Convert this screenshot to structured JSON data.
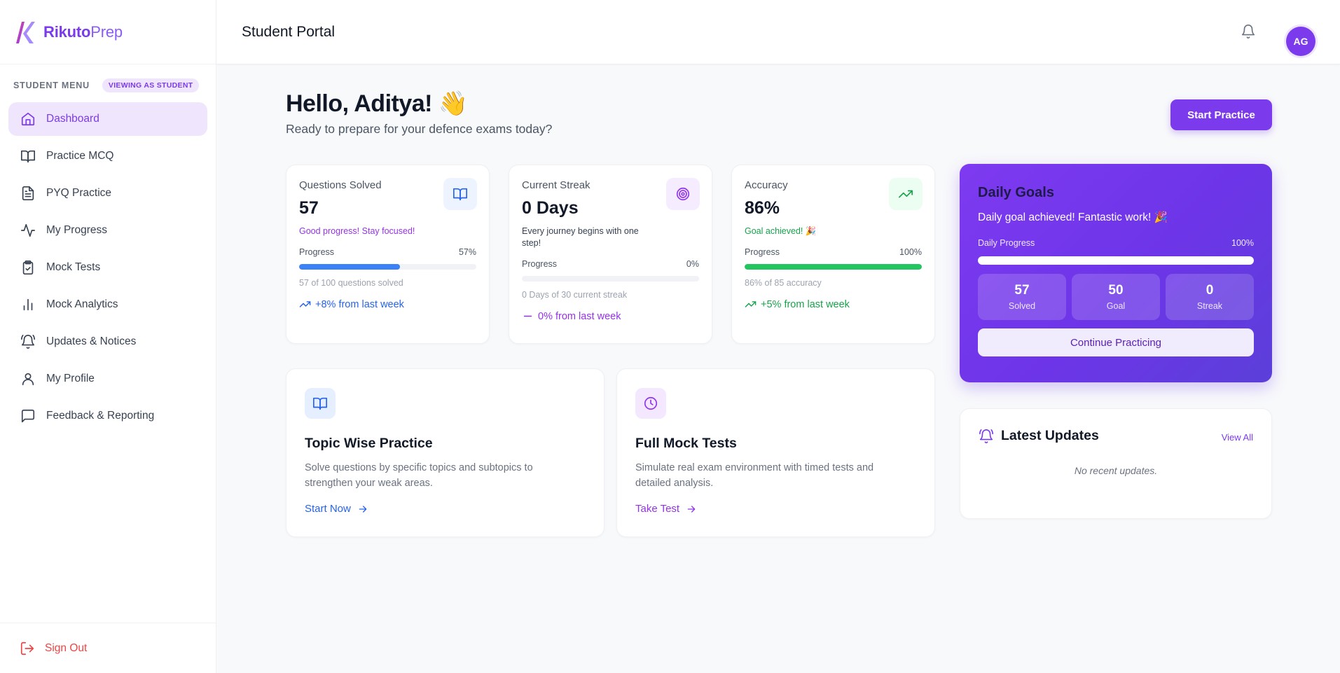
{
  "brand": {
    "name_bold": "Rikuto",
    "name_light": "Prep"
  },
  "sidebar": {
    "menu_label": "STUDENT MENU",
    "viewing_badge": "VIEWING AS STUDENT",
    "items": [
      {
        "label": "Dashboard",
        "icon": "home-icon",
        "active": true
      },
      {
        "label": "Practice MCQ",
        "icon": "book-open-icon"
      },
      {
        "label": "PYQ Practice",
        "icon": "file-text-icon"
      },
      {
        "label": "My Progress",
        "icon": "activity-icon"
      },
      {
        "label": "Mock Tests",
        "icon": "clipboard-check-icon"
      },
      {
        "label": "Mock Analytics",
        "icon": "bar-chart-icon"
      },
      {
        "label": "Updates & Notices",
        "icon": "bell-ring-icon"
      },
      {
        "label": "My Profile",
        "icon": "user-icon"
      },
      {
        "label": "Feedback & Reporting",
        "icon": "message-square-icon"
      }
    ],
    "sign_out": "Sign Out"
  },
  "header": {
    "title": "Student Portal",
    "avatar_initials": "AG"
  },
  "greeting": {
    "title": "Hello, Aditya! 👋",
    "subtitle": "Ready to prepare for your defence exams today?",
    "start_button": "Start Practice"
  },
  "stats": [
    {
      "title": "Questions Solved",
      "value": "57",
      "message": "Good progress! Stay focused!",
      "progress_label": "Progress",
      "progress_pct": "57%",
      "progress": 0.57,
      "sub": "57 of 100 questions solved",
      "trend": "+8% from last week",
      "accent": "#2563eb",
      "bar_color": "#3b82f6",
      "msg_color": "#9333ea"
    },
    {
      "title": "Current Streak",
      "value": "0 Days",
      "message": "Every journey begins with one step!",
      "progress_label": "Progress",
      "progress_pct": "0%",
      "progress": 0,
      "sub": "0 Days of 30 current streak",
      "trend": "0% from last week",
      "accent": "#9333ea",
      "bar_color": "#9333ea",
      "msg_color": "#374151"
    },
    {
      "title": "Accuracy",
      "value": "86%",
      "message": "Goal achieved! 🎉",
      "progress_label": "Progress",
      "progress_pct": "100%",
      "progress": 1,
      "sub": "86% of 85 accuracy",
      "trend": "+5% from last week",
      "accent": "#16a34a",
      "bar_color": "#22c55e",
      "msg_color": "#16a34a"
    }
  ],
  "features": [
    {
      "title": "Topic Wise Practice",
      "desc": "Solve questions by specific topics and subtopics to strengthen your weak areas.",
      "link": "Start Now",
      "color": "#2563eb"
    },
    {
      "title": "Full Mock Tests",
      "desc": "Simulate real exam environment with timed tests and detailed analysis.",
      "link": "Take Test",
      "color": "#9333ea"
    }
  ],
  "daily_goals": {
    "title": "Daily Goals",
    "message": "Daily goal achieved! Fantastic work! 🎉",
    "progress_label": "Daily Progress",
    "progress_pct": "100%",
    "progress": 1,
    "stats": [
      {
        "value": "57",
        "label": "Solved"
      },
      {
        "value": "50",
        "label": "Goal"
      },
      {
        "value": "0",
        "label": "Streak"
      }
    ],
    "button": "Continue Practicing"
  },
  "updates": {
    "title": "Latest Updates",
    "view_all": "View All",
    "empty": "No recent updates."
  }
}
